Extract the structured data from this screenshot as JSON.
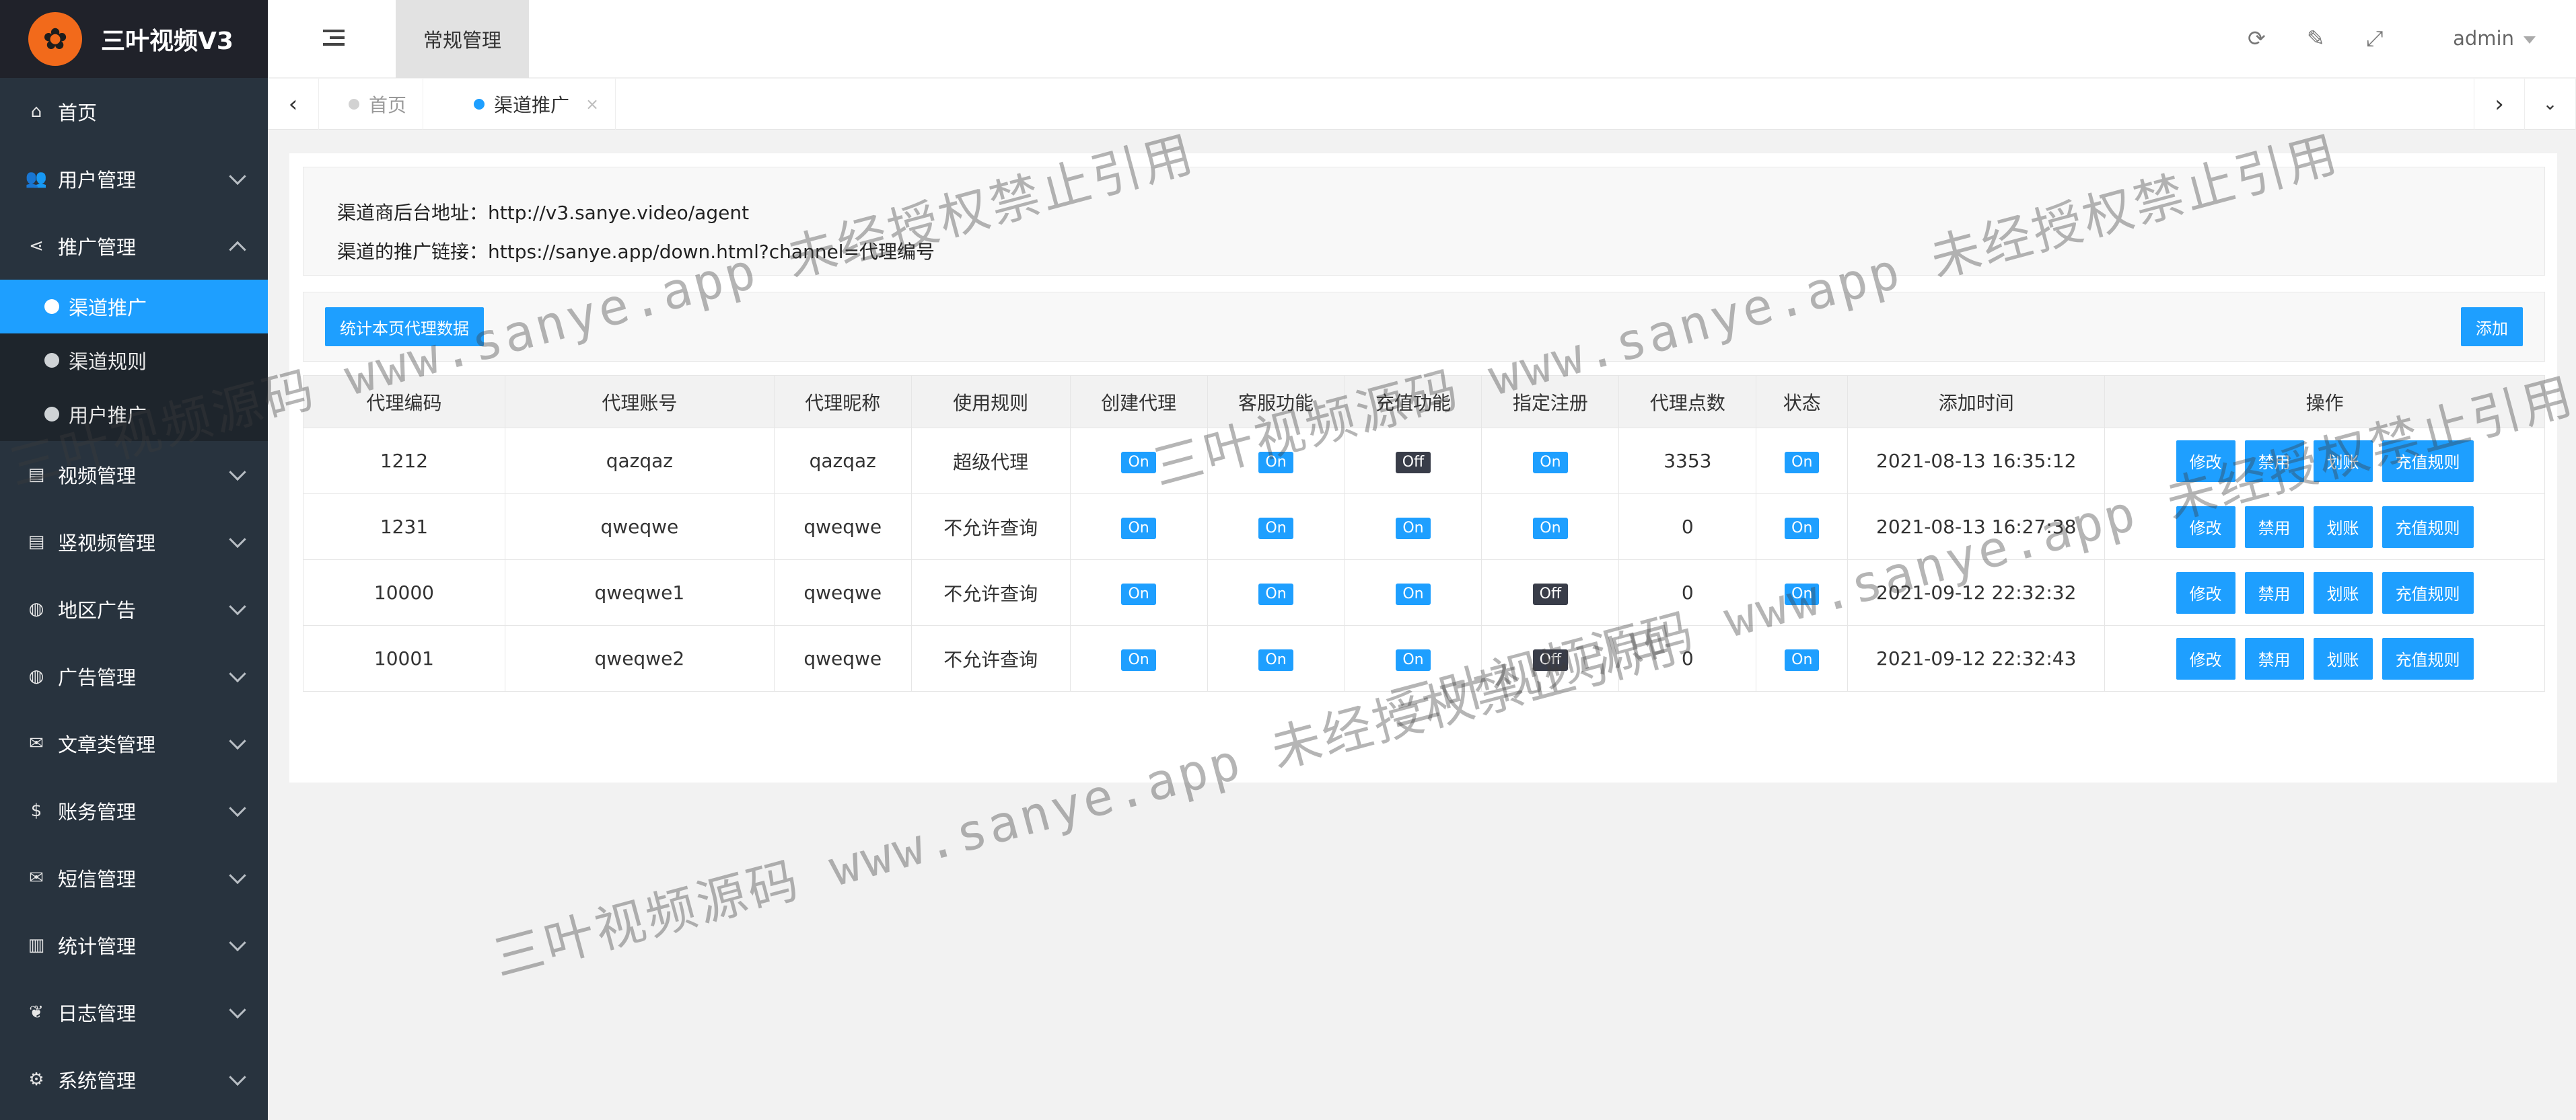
{
  "app": {
    "title": "三叶视频V3",
    "logo_icon": "clover-logo"
  },
  "sidebar": {
    "items": [
      {
        "label": "首页",
        "icon": "home-icon",
        "chevron": ""
      },
      {
        "label": "用户管理",
        "icon": "users-icon",
        "chevron": "down"
      },
      {
        "label": "推广管理",
        "icon": "share-icon",
        "chevron": "up"
      },
      {
        "label": "视频管理",
        "icon": "film-icon",
        "chevron": "down"
      },
      {
        "label": "竖视频管理",
        "icon": "film-icon",
        "chevron": "down"
      },
      {
        "label": "地区广告",
        "icon": "globe-icon",
        "chevron": "down"
      },
      {
        "label": "广告管理",
        "icon": "globe-icon",
        "chevron": "down"
      },
      {
        "label": "文章类管理",
        "icon": "mail-icon",
        "chevron": "down"
      },
      {
        "label": "账务管理",
        "icon": "dollar-icon",
        "chevron": "down"
      },
      {
        "label": "短信管理",
        "icon": "envelope-icon",
        "chevron": "down"
      },
      {
        "label": "统计管理",
        "icon": "bar-chart-icon",
        "chevron": "down"
      },
      {
        "label": "日志管理",
        "icon": "leaf-icon",
        "chevron": "down"
      },
      {
        "label": "系统管理",
        "icon": "gears-icon",
        "chevron": "down"
      }
    ],
    "submenu": [
      {
        "label": "渠道推广",
        "active": true
      },
      {
        "label": "渠道规则",
        "active": false
      },
      {
        "label": "用户推广",
        "active": false
      }
    ]
  },
  "header": {
    "top_tab": "常规管理",
    "user": "admin"
  },
  "tabs": {
    "home": "首页",
    "current": "渠道推广",
    "close": "×"
  },
  "info": {
    "backend_url": "渠道商后台地址：http://v3.sanye.video/agent",
    "promo_link": "渠道的推广链接：https://sanye.app/down.html?channel=代理编号"
  },
  "toolbar": {
    "stats_button": "统计本页代理数据",
    "add_button": "添加"
  },
  "table": {
    "headers": [
      "代理编码",
      "代理账号",
      "代理昵称",
      "使用规则",
      "创建代理",
      "客服功能",
      "充值功能",
      "指定注册",
      "代理点数",
      "状态",
      "添加时间",
      "操作"
    ],
    "rows": [
      {
        "code": "1212",
        "account": "qazqaz",
        "nickname": "qazqaz",
        "rule": "超级代理",
        "create": "On",
        "service": "On",
        "recharge": "Off",
        "register": "On",
        "points": "3353",
        "status": "On",
        "time": "2021-08-13 16:35:12"
      },
      {
        "code": "1231",
        "account": "qweqwe",
        "nickname": "qweqwe",
        "rule": "不允许查询",
        "create": "On",
        "service": "On",
        "recharge": "On",
        "register": "On",
        "points": "0",
        "status": "On",
        "time": "2021-08-13 16:27:38"
      },
      {
        "code": "10000",
        "account": "qweqwe1",
        "nickname": "qweqwe",
        "rule": "不允许查询",
        "create": "On",
        "service": "On",
        "recharge": "On",
        "register": "Off",
        "points": "0",
        "status": "On",
        "time": "2021-09-12 22:32:32"
      },
      {
        "code": "10001",
        "account": "qweqwe2",
        "nickname": "qweqwe",
        "rule": "不允许查询",
        "create": "On",
        "service": "On",
        "recharge": "On",
        "register": "Off",
        "points": "0",
        "status": "On",
        "time": "2021-09-12 22:32:43"
      }
    ],
    "actions": [
      "修改",
      "禁用",
      "划账",
      "充值规则"
    ]
  },
  "watermark": {
    "text_a": "三叶视频源码 www.sanye.app 未经授权禁止引用",
    "text_b": "三叶视频源码 www.sanye.app 未经授权禁止引用"
  },
  "colors": {
    "accent": "#1e9fff",
    "sidebar_bg": "#28333e",
    "switch_off": "#393d49",
    "logo": "#f26a1b"
  }
}
